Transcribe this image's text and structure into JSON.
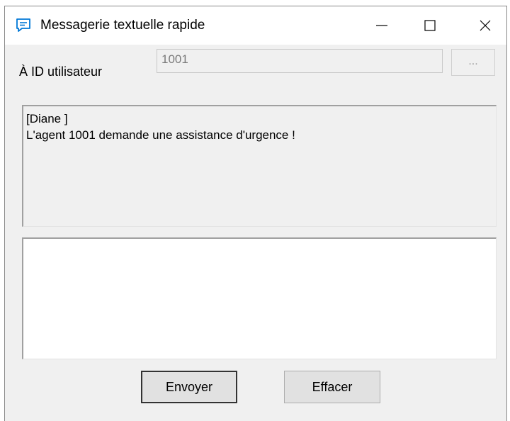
{
  "window": {
    "title": "Messagerie textuelle rapide"
  },
  "form": {
    "to_label": "À ID utilisateur",
    "user_id_value": "1001",
    "browse_label": "..."
  },
  "history": {
    "sender": "[Diane ]",
    "message": "L'agent 1001 demande une assistance d'urgence !"
  },
  "compose": {
    "value": ""
  },
  "buttons": {
    "send_label": "Envoyer",
    "clear_label": "Effacer"
  },
  "colors": {
    "accent": "#0078d7",
    "window_bg": "#f0f0f0"
  }
}
